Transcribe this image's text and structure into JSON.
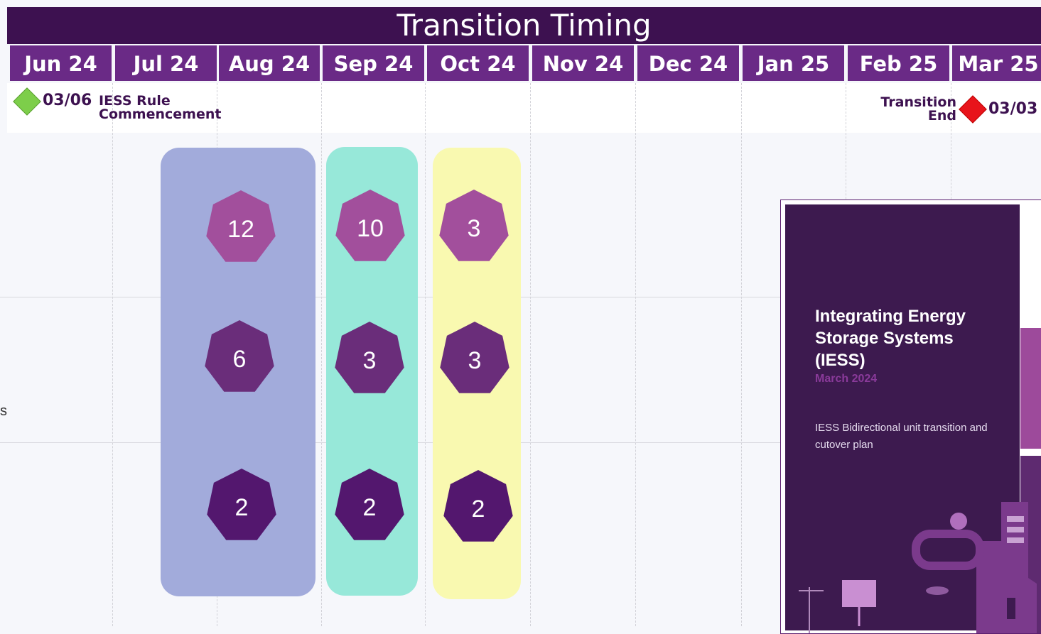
{
  "title": "Transition Timing",
  "months": [
    "Jun 24",
    "Jul 24",
    "Aug 24",
    "Sep 24",
    "Oct 24",
    "Nov 24",
    "Dec 24",
    "Jan 25",
    "Feb 25",
    "Mar 25"
  ],
  "milestones": {
    "start": {
      "date": "03/06",
      "label_line1": "IESS Rule",
      "label_line2": "Commencement",
      "color": "#7dce4a"
    },
    "end": {
      "date": "03/03",
      "label_line1": "Transition",
      "label_line2": "End",
      "color": "#e8141b"
    }
  },
  "groups": [
    {
      "name": "group-1",
      "color": "#a2abdb",
      "counts": [
        12,
        6,
        2
      ]
    },
    {
      "name": "group-2",
      "color": "#97e8d9",
      "counts": [
        10,
        3,
        2
      ]
    },
    {
      "name": "group-3",
      "color": "#f9f9b0",
      "counts": [
        3,
        3,
        2
      ]
    }
  ],
  "row_colors": [
    "#a24f9c",
    "#6a2d7a",
    "#53176e"
  ],
  "cover": {
    "title": "Integrating Energy Storage Systems (IESS)",
    "date": "March 2024",
    "description": "IESS Bidirectional unit transition and cutover plan"
  },
  "left_stub_text": "s"
}
